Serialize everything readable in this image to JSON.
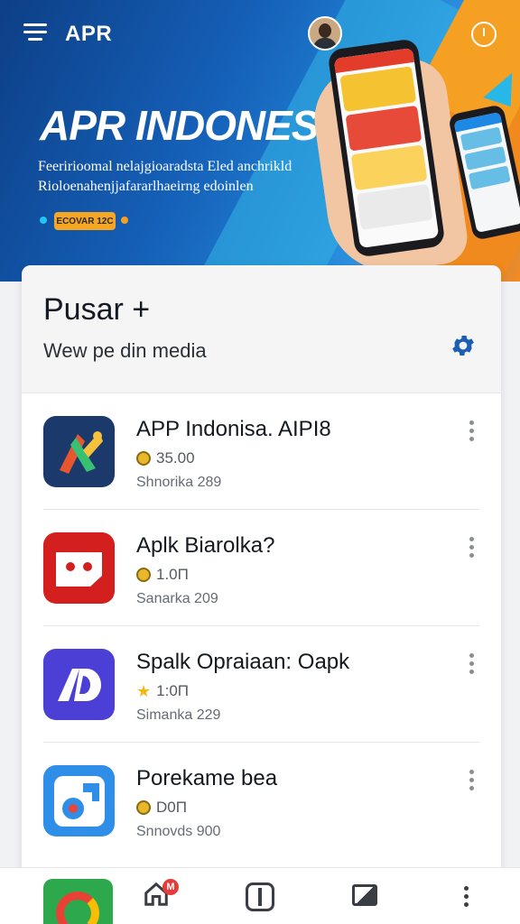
{
  "header": {
    "app_title": "APR",
    "menu_icon": "hamburger-menu-icon",
    "timer_icon": "timer-icon"
  },
  "hero": {
    "heading": "APR INDONESIA",
    "subtitle": "Feeririoomal nelajgioaradsta Eled anchrikld Rioloenahenjjafararlhaeirng edoinlen",
    "badge": "ECOVAR 12C"
  },
  "panel": {
    "title": "Pusar +",
    "subtitle": "Wew pe din media",
    "settings_icon": "gear-icon"
  },
  "apps": [
    {
      "name": "APP Indonisa. AIPI8",
      "price": "35.00",
      "price_icon": "coin-icon",
      "downloads": "Shnorika 289",
      "icon_color": "#1b3a6b"
    },
    {
      "name": "Aplk Biarolka?",
      "price": "1.0Π",
      "price_icon": "coin-icon",
      "downloads": "Sanarka 209",
      "icon_color": "#d41f1f"
    },
    {
      "name": "Spalk Opraiaan: Oapk",
      "price": "1:0Π",
      "price_icon": "star-icon",
      "downloads": "Simanka 229",
      "icon_color": "#4b3fd6"
    },
    {
      "name": "Porekame bea",
      "price": "D0Π",
      "price_icon": "coin-icon",
      "downloads": "Snnovds 900",
      "icon_color": "#2f8fe8"
    }
  ],
  "bottom_nav": {
    "home_badge": "M",
    "items": [
      "app-launcher-icon",
      "home-icon",
      "tablet-icon",
      "gallery-icon",
      "more-vertical-icon"
    ]
  },
  "colors": {
    "hero_blue": "#0d3f86",
    "hero_orange": "#f58a1f",
    "accent_blue": "#1565c0",
    "badge_orange": "#f5a623"
  }
}
